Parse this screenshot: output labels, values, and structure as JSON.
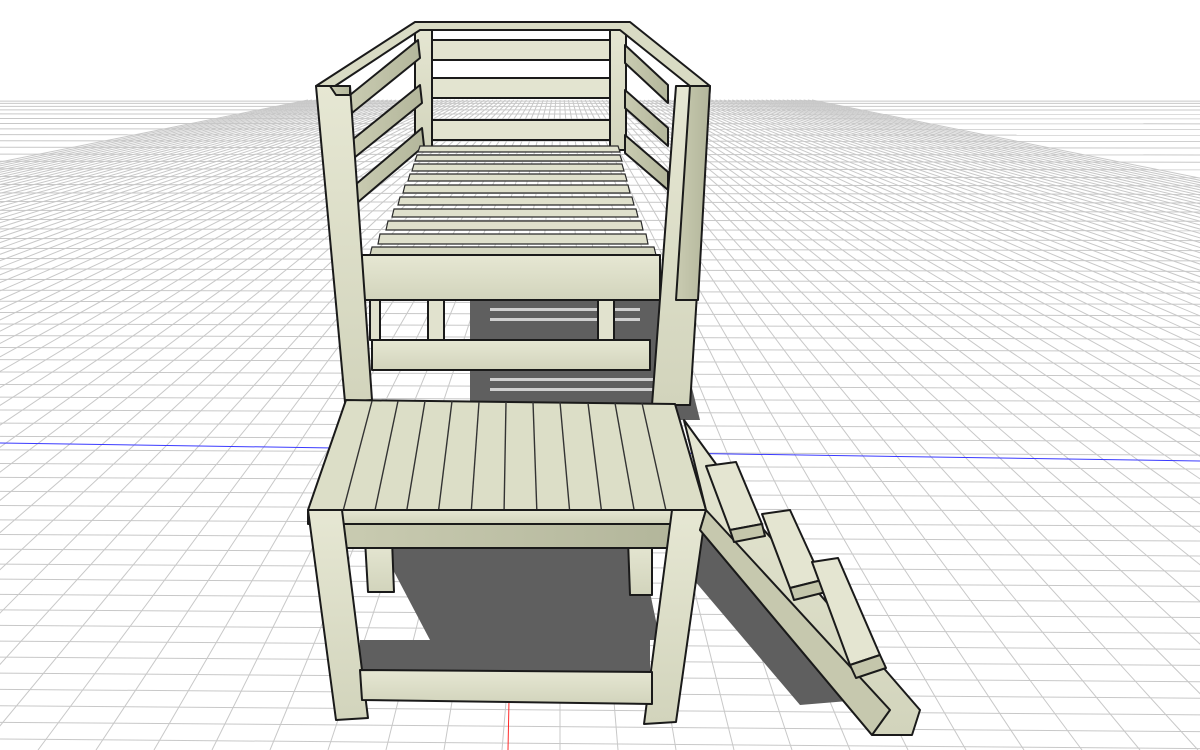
{
  "viewport": {
    "type": "3d-model-view",
    "background_color": "#ffffff",
    "grid_color": "#c8c8c8",
    "x_axis_color": "#3a3aff",
    "y_axis_color": "#ff2a2a",
    "wood_face_color": "#dcdec8",
    "wood_light_color": "#e8e9d8",
    "wood_dark_color": "#b9bca2",
    "shadow_color": "#5c5c5c",
    "outline_color": "#1a1a1a"
  },
  "model": {
    "name": "",
    "parts": [
      "bed-frame",
      "bed-slats",
      "seat-bench",
      "ramp-steps"
    ]
  }
}
